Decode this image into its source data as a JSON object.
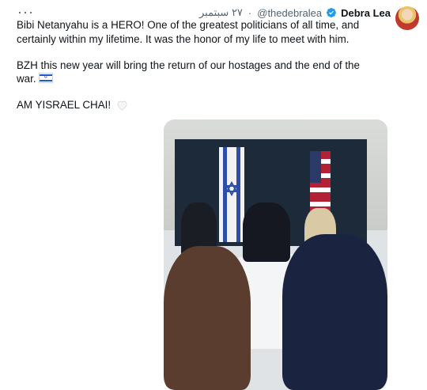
{
  "header": {
    "more_label": "···",
    "name": "Debra Lea",
    "handle": "@thedebralea",
    "time": "٢٧ سبتمبر"
  },
  "tweet": {
    "lines": [
      "Bibi Netanyahu is a HERO! One of the greatest politicians of all time, and",
      "certainly within my lifetime. It was the honor of my life to meet with him.",
      "",
      "BZH this new year will bring the return of our hostages and the end of the",
      "war.",
      "",
      "AM YISRAEL CHAI!"
    ]
  },
  "colors": {
    "verified": "#1d9bf0",
    "muted": "#536471",
    "text": "#0f1419"
  },
  "icons": {
    "verified": "verified-badge-icon",
    "flag": "israel-flag-emoji",
    "heart": "white-heart-emoji"
  },
  "photo": {
    "alt": "meeting photo"
  }
}
